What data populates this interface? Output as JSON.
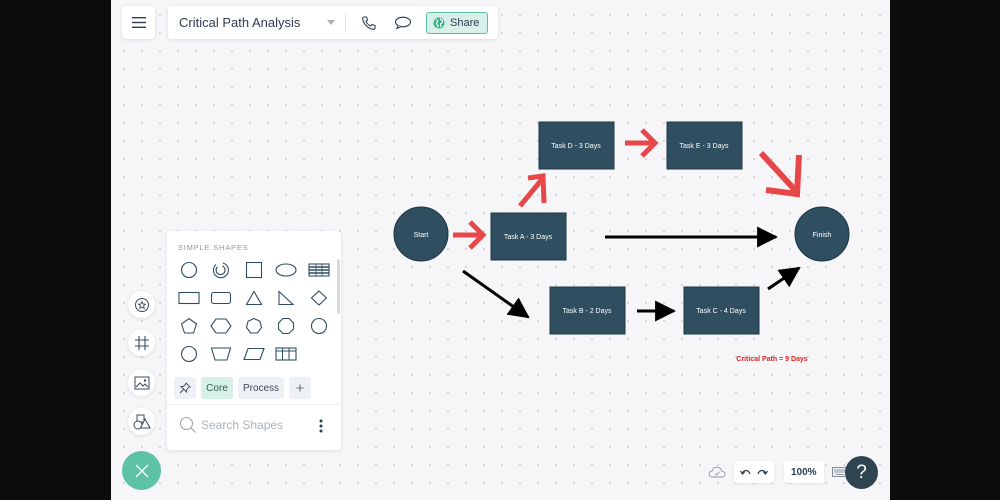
{
  "header": {
    "menu_icon": "hamburger-icon",
    "document_title": "Critical Path Analysis",
    "share_label": "Share",
    "call_icon": "phone-icon",
    "comment_icon": "comment-icon",
    "share_icon": "globe-icon"
  },
  "diagram": {
    "nodes": [
      {
        "id": "start",
        "label": "Start",
        "shape": "circle"
      },
      {
        "id": "task-a",
        "label": "Task A - 3 Days",
        "shape": "rect"
      },
      {
        "id": "task-d",
        "label": "Task D - 3 Days",
        "shape": "rect"
      },
      {
        "id": "task-e",
        "label": "Task E - 3 Days",
        "shape": "rect"
      },
      {
        "id": "task-b",
        "label": "Task B - 2 Days",
        "shape": "rect"
      },
      {
        "id": "task-c",
        "label": "Task C - 4 Days",
        "shape": "rect"
      },
      {
        "id": "finish",
        "label": "Finish",
        "shape": "circle"
      }
    ],
    "edges": [
      {
        "from": "start",
        "to": "task-a",
        "critical": true
      },
      {
        "from": "task-a",
        "to": "task-d",
        "critical": true
      },
      {
        "from": "task-d",
        "to": "task-e",
        "critical": true
      },
      {
        "from": "task-e",
        "to": "finish",
        "critical": true
      },
      {
        "from": "task-a",
        "to": "finish",
        "critical": false
      },
      {
        "from": "start",
        "to": "task-b",
        "critical": false
      },
      {
        "from": "task-b",
        "to": "task-c",
        "critical": false
      },
      {
        "from": "task-c",
        "to": "finish",
        "critical": false
      }
    ],
    "annotation": "Critical Path = 9 Days",
    "colors": {
      "node_fill": "#2f4f61",
      "critical_arrow": "#e8474a",
      "normal_arrow": "#000000",
      "annotation": "#e02424"
    }
  },
  "shapes_panel": {
    "header": "SIMPLE SHAPES",
    "shapes": [
      [
        "circle",
        "donut",
        "square",
        "ellipse",
        "table-striped"
      ],
      [
        "rectangle",
        "rounded-rectangle",
        "triangle",
        "right-triangle",
        "diamond"
      ],
      [
        "pentagon",
        "hexagon",
        "heptagon",
        "octagon",
        "decagon"
      ],
      [
        "circle-small",
        "trapezoid",
        "parallelogram",
        "table-grid"
      ]
    ],
    "pin_icon": "pin-icon",
    "tabs": [
      {
        "label": "Core",
        "active": true
      },
      {
        "label": "Process",
        "active": false
      }
    ],
    "add_tab_label": "+",
    "search_placeholder": "Search Shapes"
  },
  "side_toolbar": [
    {
      "name": "sticker-icon"
    },
    {
      "name": "frame-icon"
    },
    {
      "name": "image-icon"
    },
    {
      "name": "shapes-icon"
    }
  ],
  "bottom_bar": {
    "zoom_level": "100%",
    "help_label": "?",
    "cloud_icon": "cloud-saved-icon",
    "undo_icon": "undo-icon",
    "redo_icon": "redo-icon",
    "keyboard_icon": "keyboard-icon"
  },
  "colors": {
    "accent": "#5ec2a6",
    "share_bg": "#d7f1ea",
    "text": "#2c3e50"
  }
}
